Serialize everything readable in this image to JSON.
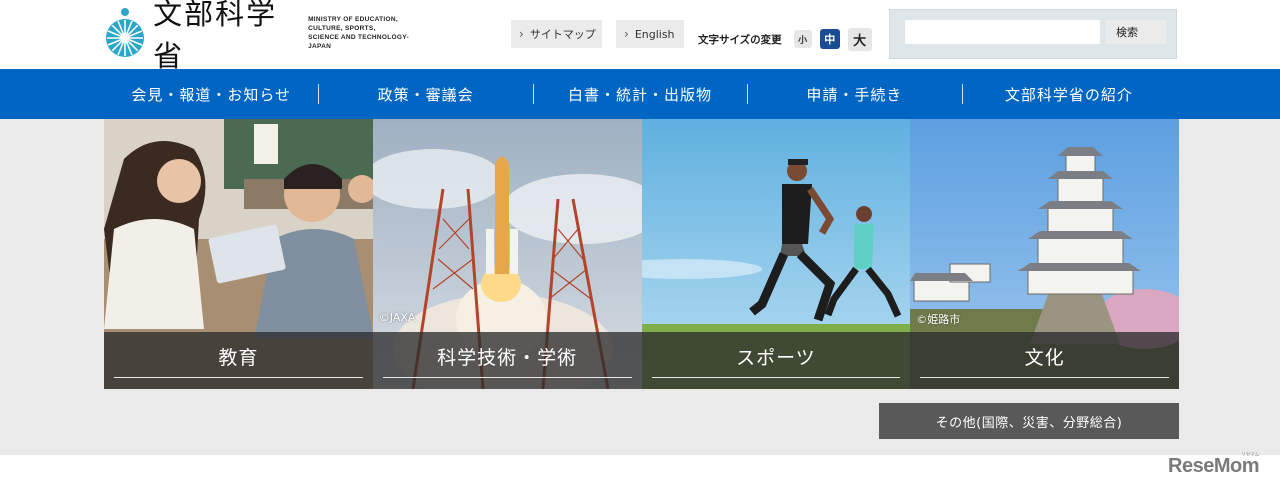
{
  "header": {
    "logo_name": "文部科学省",
    "logo_en": "MINISTRY OF EDUCATION,\nCULTURE, SPORTS,\nSCIENCE AND TECHNOLOGY-JAPAN",
    "sitemap_label": "サイトマップ",
    "english_label": "English",
    "font_size_label": "文字サイズの変更",
    "font_sizes": [
      "小",
      "中",
      "大"
    ],
    "selected_font_size": "中",
    "search_placeholder": "",
    "search_button": "検索"
  },
  "nav": {
    "items": [
      "会見・報道・お知らせ",
      "政策・審議会",
      "白書・統計・出版物",
      "申請・手続き",
      "文部科学省の紹介"
    ]
  },
  "tiles": [
    {
      "label": "教育",
      "credit": ""
    },
    {
      "label": "科学技術・学術",
      "credit": "©JAXA"
    },
    {
      "label": "スポーツ",
      "credit": ""
    },
    {
      "label": "文化",
      "credit": "©姫路市"
    }
  ],
  "other_button": "その他(国際、災害、分野総合)",
  "watermark": {
    "text": "ReseMom",
    "small": "リセマム"
  },
  "colors": {
    "nav": "#0065c3",
    "font_mid": "#1a4c96",
    "logo": "#2aa6c9"
  }
}
